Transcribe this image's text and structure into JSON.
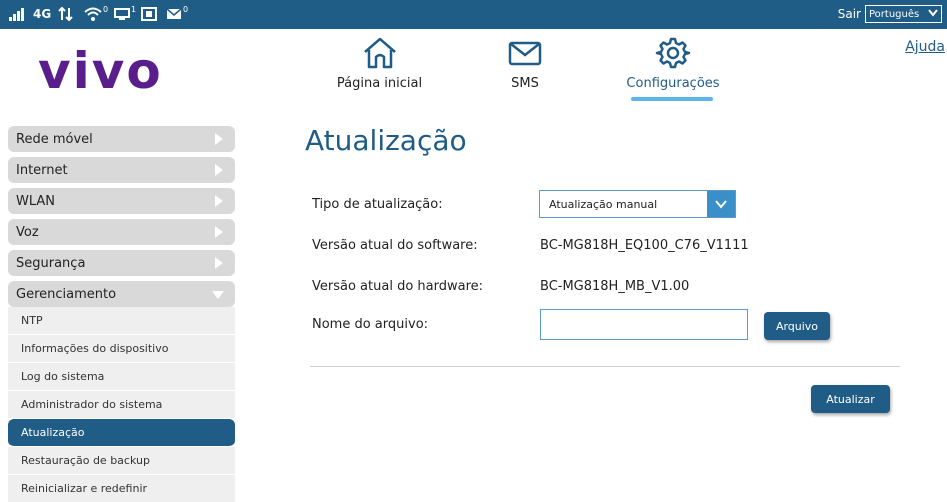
{
  "status_bar": {
    "network": "4G",
    "wifi_count": "0",
    "device_count": "1",
    "sms_count": "0",
    "logout_label": "Sair",
    "language": "Português"
  },
  "brand": {
    "logo_text": "vivo"
  },
  "help_label": "Ajuda",
  "top_nav": {
    "home_label": "Página inicial",
    "sms_label": "SMS",
    "config_label": "Configurações"
  },
  "sidebar": {
    "main_items": [
      {
        "label": "Rede móvel"
      },
      {
        "label": "Internet"
      },
      {
        "label": "WLAN"
      },
      {
        "label": "Voz"
      },
      {
        "label": "Segurança"
      },
      {
        "label": "Gerenciamento"
      }
    ],
    "sub_items": [
      {
        "label": "NTP"
      },
      {
        "label": "Informações do dispositivo"
      },
      {
        "label": "Log do sistema"
      },
      {
        "label": "Administrador do sistema"
      },
      {
        "label": "Atualização"
      },
      {
        "label": "Restauração de backup"
      },
      {
        "label": "Reinicializar e redefinir"
      }
    ],
    "active_sub": "Atualização"
  },
  "main": {
    "title": "Atualização",
    "update_type_label": "Tipo de atualização:",
    "update_type_value": "Atualização manual",
    "software_label": "Versão atual do software:",
    "software_value": "BC-MG818H_EQ100_C76_V1111",
    "hardware_label": "Versão atual do hardware:",
    "hardware_value": "BC-MG818H_MB_V1.00",
    "filename_label": "Nome do arquivo:",
    "filename_value": "",
    "file_button": "Arquivo",
    "update_button": "Atualizar"
  },
  "colors": {
    "header_blue": "#1f5c86",
    "brand_purple": "#5a1e8c",
    "accent_light_blue": "#5bb5e6"
  }
}
